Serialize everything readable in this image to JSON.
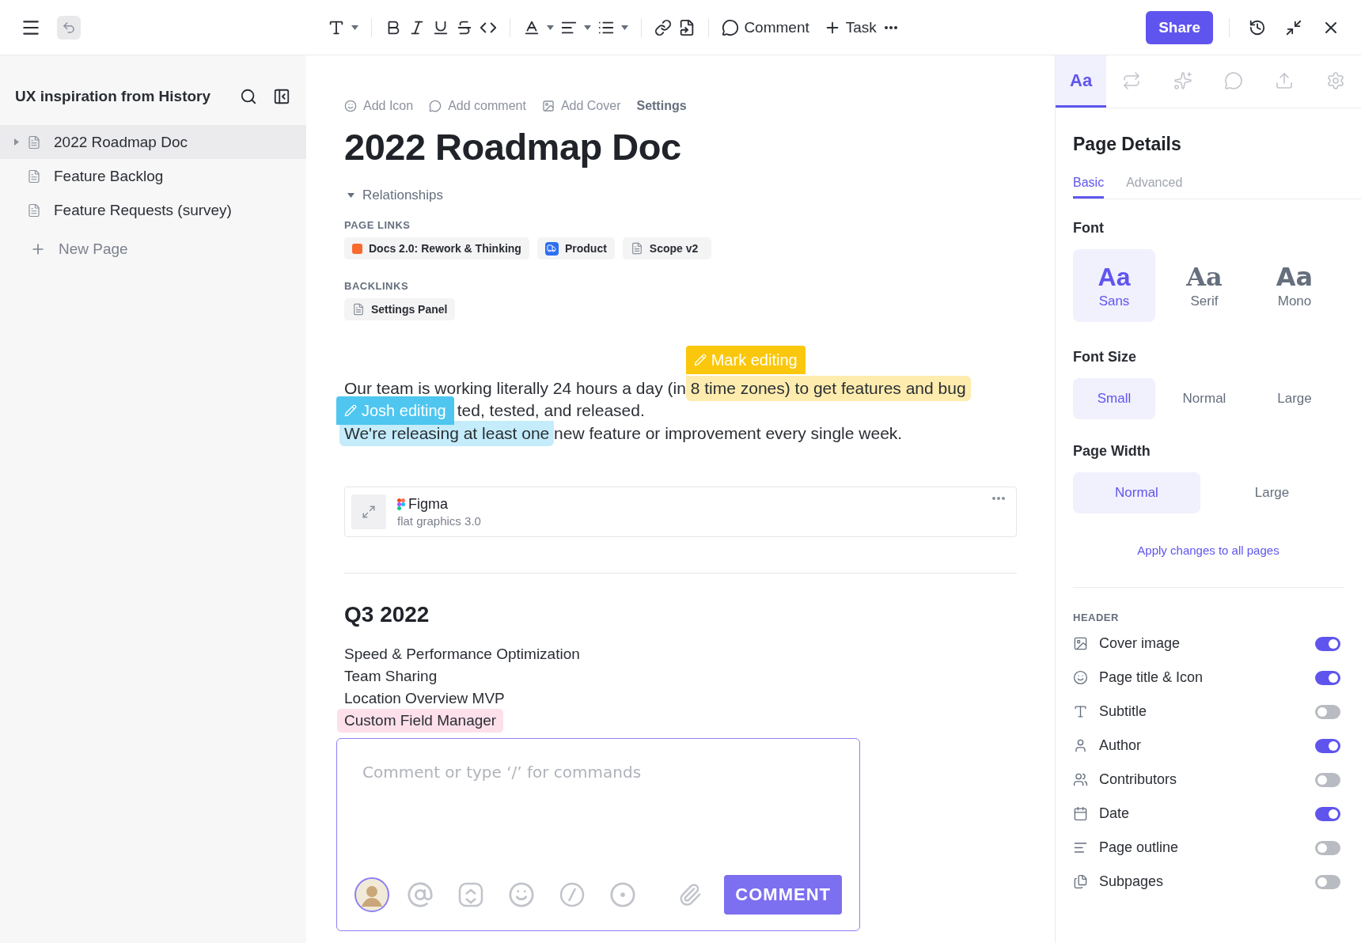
{
  "toolbar": {
    "comment": "Comment",
    "task": "Task",
    "share": "Share"
  },
  "sidebar": {
    "title": "UX inspiration from History",
    "items": [
      {
        "label": "2022 Roadmap Doc",
        "selected": true,
        "has_children": true
      },
      {
        "label": "Feature Backlog",
        "selected": false,
        "has_children": false
      },
      {
        "label": "Feature Requests (survey)",
        "selected": false,
        "has_children": false
      }
    ],
    "new_page": "New Page"
  },
  "doc": {
    "actions": [
      {
        "kind": "icon",
        "label": "Add Icon"
      },
      {
        "kind": "comment",
        "label": "Add comment"
      },
      {
        "kind": "cover",
        "label": "Add Cover"
      },
      {
        "kind": "settings",
        "label": "Settings"
      }
    ],
    "title": "2022 Roadmap Doc",
    "relationships": {
      "label": "Relationships",
      "expanded": true
    },
    "page_links": {
      "heading": "PAGE LINKS",
      "items": [
        {
          "kind": "color",
          "label": "Docs 2.0: Rework & Thinking",
          "color": "#f86a2d"
        },
        {
          "kind": "product",
          "label": "Product",
          "color": "#2e6ff2"
        },
        {
          "kind": "doc",
          "label": "Scope v2"
        }
      ]
    },
    "backlinks": {
      "heading": "BACKLINKS",
      "items": [
        {
          "kind": "doc",
          "label": "Settings Panel"
        }
      ]
    },
    "paragraph": {
      "lines": [
        {
          "segments": [
            {
              "text": "Our team is working literally 24 hours a day (in "
            },
            {
              "text": "8 time zones) to get features and bug",
              "highlight": {
                "color": "#fbc70c",
                "tag": "Mark editing"
              }
            }
          ]
        },
        {
          "tag": {
            "name": "Josh editing",
            "color": "#4ec6f0"
          },
          "segments": [
            {
              "text": "ted, tested, and released."
            }
          ]
        },
        {
          "segments": [
            {
              "text": "We're releasing at least one",
              "highlight": {
                "color": "#4ec6f0"
              }
            },
            {
              "text": " new feature or improvement every single week."
            }
          ]
        }
      ]
    },
    "embed": {
      "title": "Figma",
      "subtitle": "flat graphics 3.0"
    },
    "section": {
      "heading": "Q3 2022",
      "items": [
        {
          "text": "Speed & Performance Optimization",
          "highlighted": false
        },
        {
          "text": "Team Sharing",
          "highlighted": false
        },
        {
          "text": "Location Overview MVP",
          "highlighted": false
        },
        {
          "text": "Custom Field Manager",
          "highlighted": true
        }
      ]
    },
    "comment_box": {
      "placeholder": "Comment or type ‘/’ for commands",
      "button": "COMMENT"
    }
  },
  "panel": {
    "tabs": [
      {
        "kind": "text",
        "label": "Aa",
        "selected": true
      },
      {
        "kind": "arrows",
        "selected": false
      },
      {
        "kind": "magic",
        "selected": false
      },
      {
        "kind": "comment",
        "selected": false
      },
      {
        "kind": "upload",
        "selected": false
      },
      {
        "kind": "settings",
        "selected": false
      }
    ],
    "title": "Page Details",
    "subtabs": [
      {
        "label": "Basic",
        "selected": true
      },
      {
        "label": "Advanced",
        "selected": false
      }
    ],
    "font": {
      "label": "Font",
      "options": [
        {
          "kind": "sans",
          "sample": "Aa",
          "label": "Sans",
          "selected": true
        },
        {
          "kind": "serif",
          "sample": "Aa",
          "label": "Serif",
          "selected": false
        },
        {
          "kind": "mono",
          "sample": "Aa",
          "label": "Mono",
          "selected": false
        }
      ]
    },
    "font_size": {
      "label": "Font Size",
      "options": [
        {
          "label": "Small",
          "selected": true
        },
        {
          "label": "Normal",
          "selected": false
        },
        {
          "label": "Large",
          "selected": false
        }
      ]
    },
    "page_width": {
      "label": "Page Width",
      "options": [
        {
          "label": "Normal",
          "selected": true
        },
        {
          "label": "Large",
          "selected": false
        }
      ]
    },
    "apply": "Apply changes to all pages",
    "header": {
      "heading": "HEADER",
      "items": [
        {
          "kind": "image",
          "label": "Cover image",
          "on": true
        },
        {
          "kind": "smile",
          "label": "Page title & Icon",
          "on": true
        },
        {
          "kind": "subtitle",
          "label": "Subtitle",
          "on": false
        },
        {
          "kind": "user",
          "label": "Author",
          "on": true
        },
        {
          "kind": "users",
          "label": "Contributors",
          "on": false
        },
        {
          "kind": "calendar",
          "label": "Date",
          "on": true
        },
        {
          "kind": "outline",
          "label": "Page outline",
          "on": false
        },
        {
          "kind": "pages",
          "label": "Subpages",
          "on": false
        }
      ]
    }
  }
}
